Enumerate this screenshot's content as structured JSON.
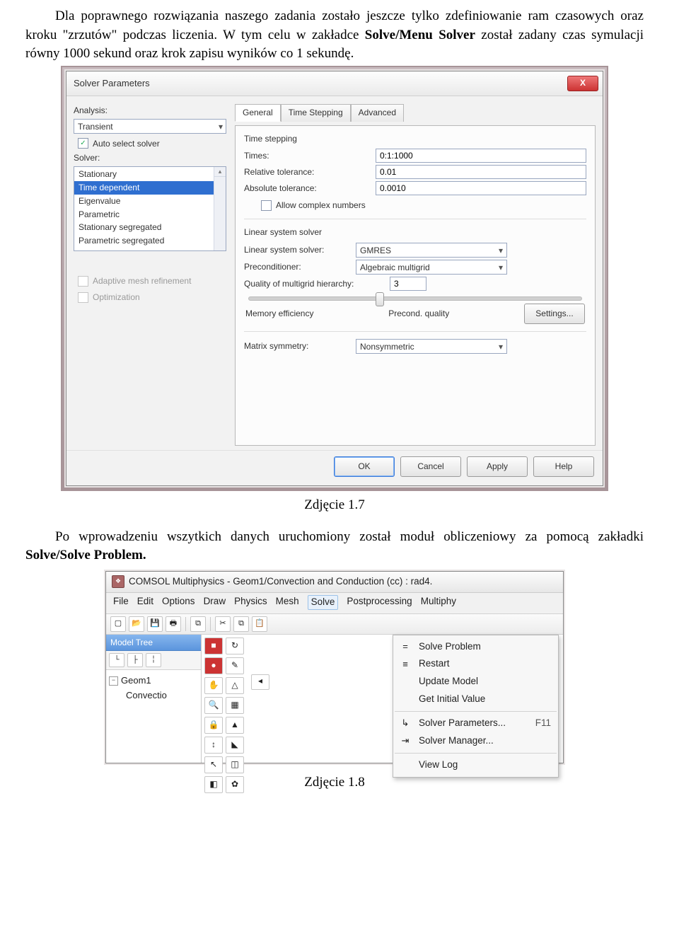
{
  "text": {
    "p1a": "Dla poprawnego rozwiązania naszego zadania zostało jeszcze tylko zdefiniowanie ram czasowych oraz kroku \"zrzutów\" podczas liczenia. W tym celu w zakładce ",
    "p1b": "Solve/Menu Solver",
    "p1c": " został zadany czas symulacji  równy 1000 sekund oraz krok zapisu wyników co 1 sekundę.",
    "cap1": "Zdjęcie 1.7",
    "p2a": "Po wprowadzeniu wszytkich danych uruchomiony został moduł obliczeniowy za pomocą zakładki ",
    "p2b": "Solve/Solve Problem.",
    "cap2": "Zdjęcie 1.8"
  },
  "dlg": {
    "title": "Solver Parameters",
    "close": "X",
    "left": {
      "analysis_label": "Analysis:",
      "analysis_value": "Transient",
      "auto_select": "Auto select solver",
      "solver_label": "Solver:",
      "solver_items": [
        "Stationary",
        "Time dependent",
        "Eigenvalue",
        "Parametric",
        "Stationary segregated",
        "Parametric segregated"
      ],
      "adaptive": "Adaptive mesh refinement",
      "optimization": "Optimization"
    },
    "tabs": {
      "t1": "General",
      "t2": "Time Stepping",
      "t3": "Advanced"
    },
    "ts": {
      "group1": "Time stepping",
      "times_k": "Times:",
      "times_v": "0:1:1000",
      "reltol_k": "Relative tolerance:",
      "reltol_v": "0.01",
      "abstol_k": "Absolute tolerance:",
      "abstol_v": "0.0010",
      "allow_complex": "Allow complex numbers",
      "group2": "Linear system solver",
      "lss_k": "Linear system solver:",
      "lss_v": "GMRES",
      "prec_k": "Preconditioner:",
      "prec_v": "Algebraic multigrid",
      "qmh_k": "Quality of multigrid hierarchy:",
      "qmh_v": "3",
      "mem": "Memory efficiency",
      "pq": "Precond. quality",
      "settings": "Settings...",
      "msym_k": "Matrix symmetry:",
      "msym_v": "Nonsymmetric"
    },
    "buttons": {
      "ok": "OK",
      "cancel": "Cancel",
      "apply": "Apply",
      "help": "Help"
    }
  },
  "win2": {
    "title": "COMSOL Multiphysics - Geom1/Convection and Conduction (cc) : rad4.",
    "menu": {
      "file": "File",
      "edit": "Edit",
      "options": "Options",
      "draw": "Draw",
      "physics": "Physics",
      "mesh": "Mesh",
      "solve": "Solve",
      "post": "Postprocessing",
      "multi": "Multiphy"
    },
    "tree": {
      "header": "Model Tree",
      "geom": "Geom1",
      "child": "Convectio"
    },
    "solve_menu": {
      "i1": "Solve Problem",
      "i2": "Restart",
      "i3": "Update Model",
      "i4": "Get Initial Value",
      "i5": "Solver Parameters...",
      "i5k": "F11",
      "i6": "Solver Manager...",
      "i7": "View Log"
    }
  }
}
